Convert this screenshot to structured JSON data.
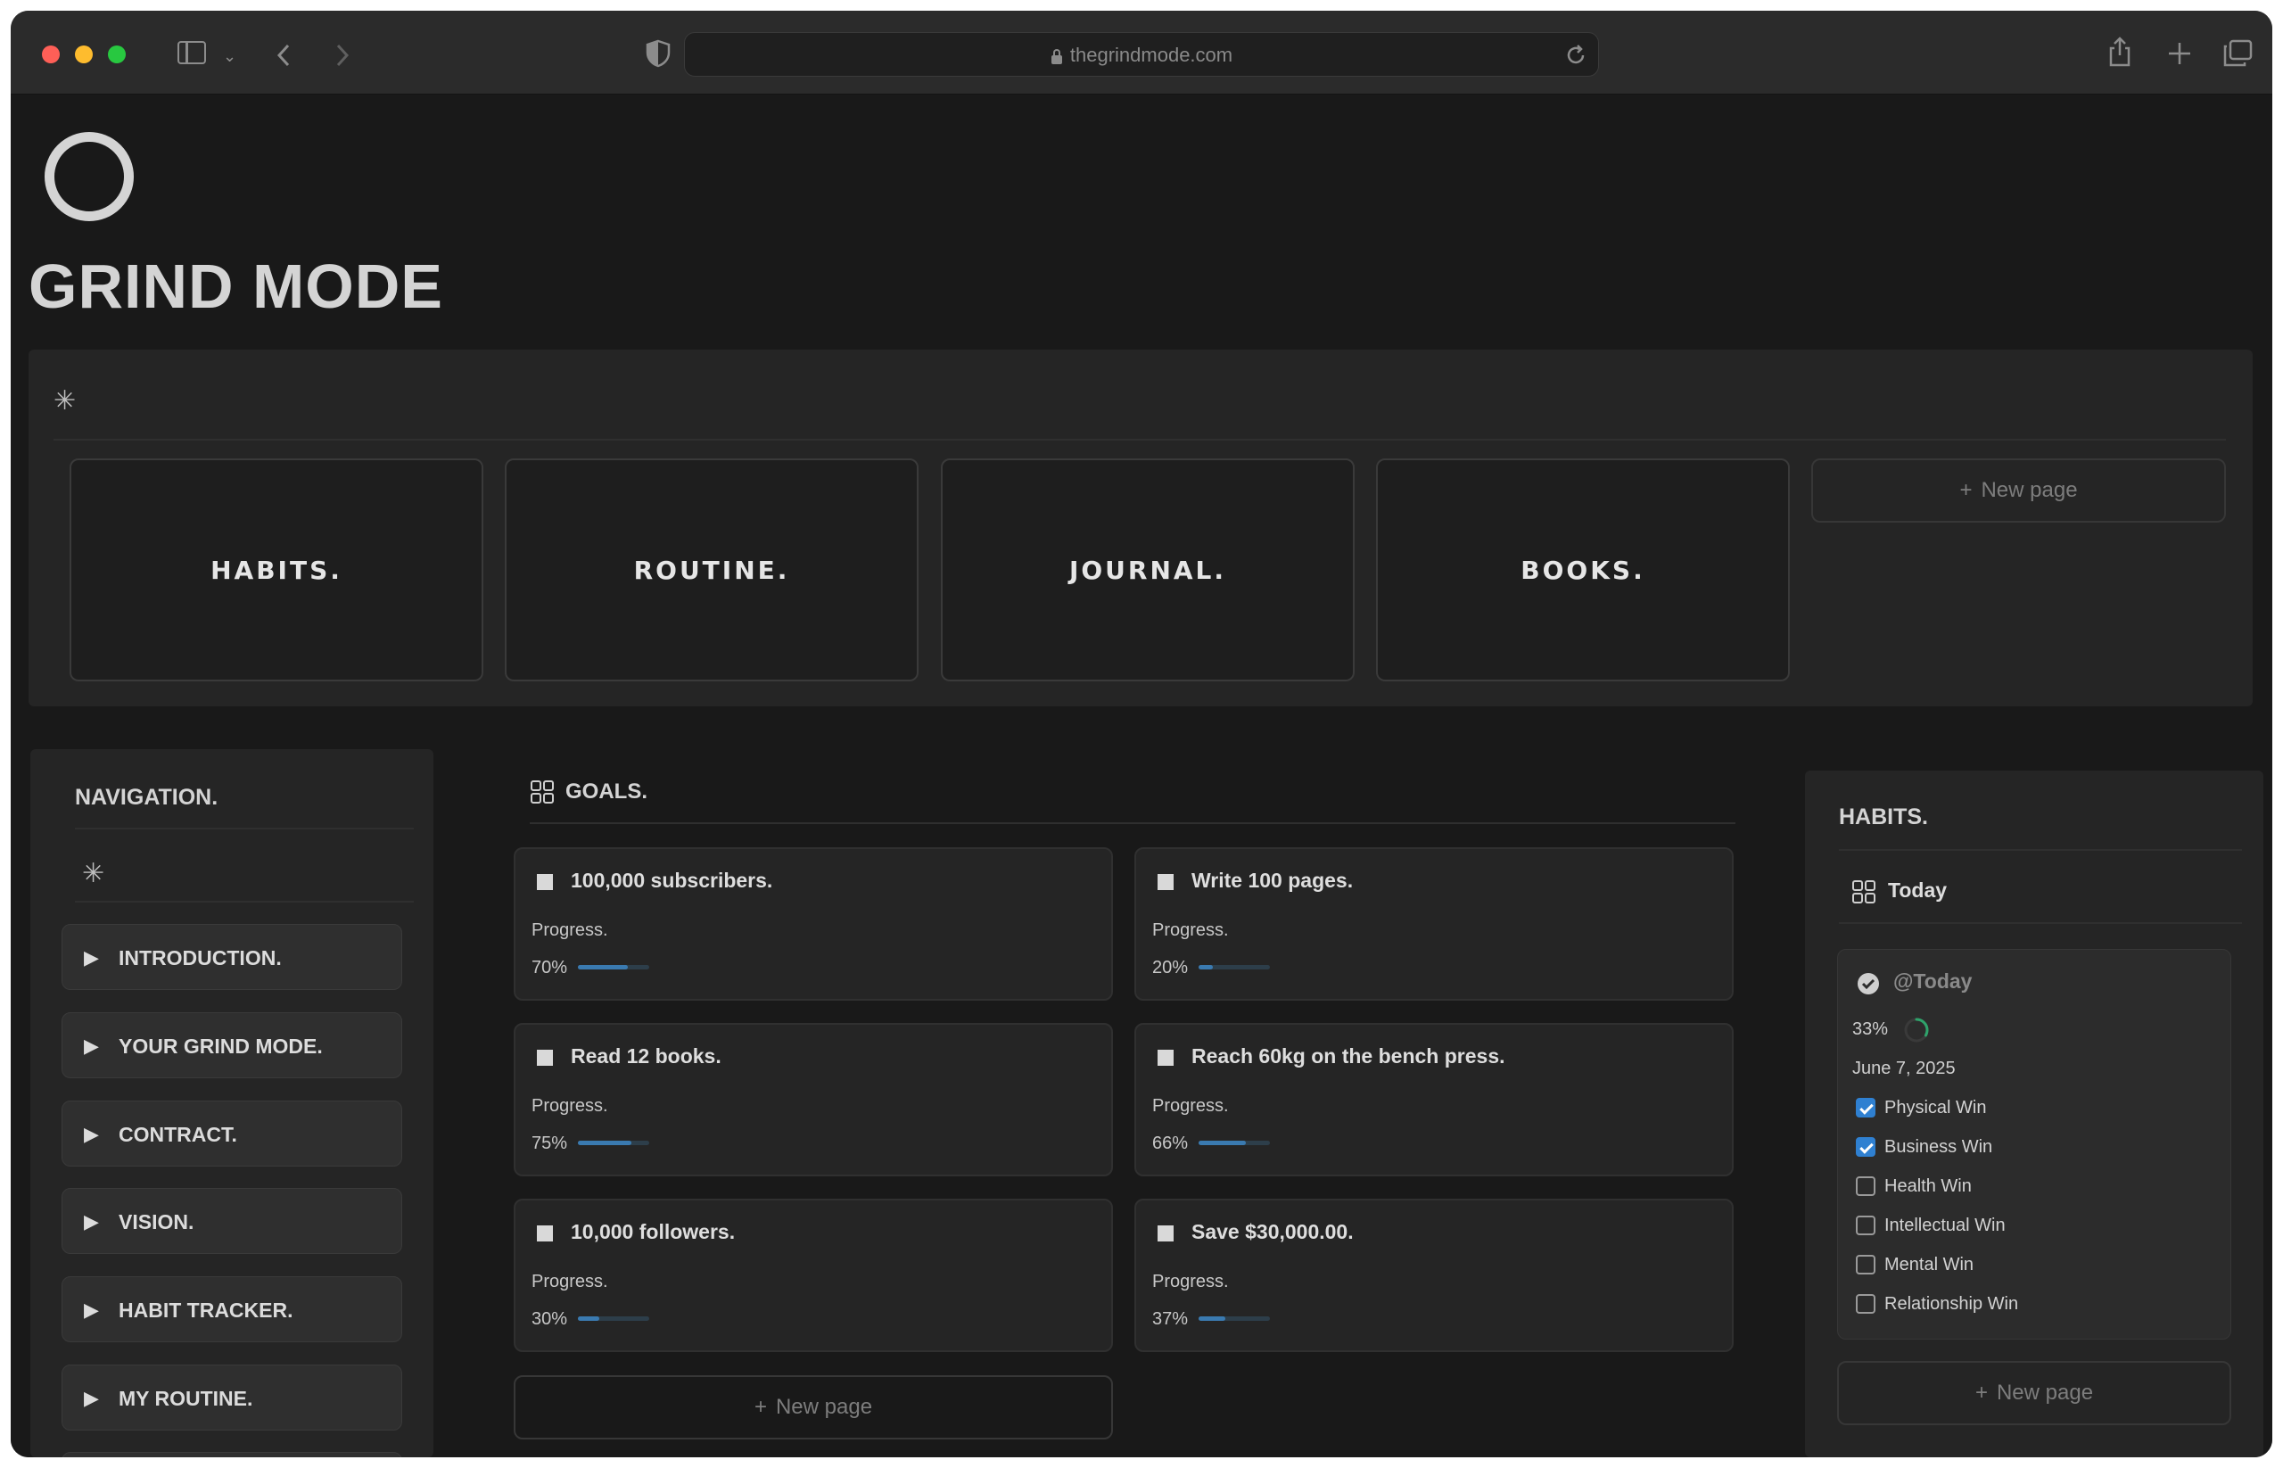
{
  "browser": {
    "url": "thegrindmode.com"
  },
  "page": {
    "title": "GRIND MODE"
  },
  "gallery": {
    "cards": [
      "HABITS.",
      "ROUTINE.",
      "JOURNAL.",
      "BOOKS."
    ],
    "new_page": "New page"
  },
  "navigation": {
    "title": "NAVIGATION.",
    "items": [
      "INTRODUCTION.",
      "YOUR GRIND MODE.",
      "CONTRACT.",
      "VISION.",
      "HABIT TRACKER.",
      "MY ROUTINE."
    ]
  },
  "goals": {
    "title": "GOALS.",
    "new_page": "New page",
    "items": [
      {
        "name": "100,000 subscribers.",
        "progress_label": "Progress.",
        "percent": "70%",
        "value": 70
      },
      {
        "name": "Write 100 pages.",
        "progress_label": "Progress.",
        "percent": "20%",
        "value": 20
      },
      {
        "name": "Read 12 books.",
        "progress_label": "Progress.",
        "percent": "75%",
        "value": 75
      },
      {
        "name": "Reach 60kg on the bench press.",
        "progress_label": "Progress.",
        "percent": "66%",
        "value": 66
      },
      {
        "name": "10,000 followers.",
        "progress_label": "Progress.",
        "percent": "30%",
        "value": 30
      },
      {
        "name": "Save $30,000.00.",
        "progress_label": "Progress.",
        "percent": "37%",
        "value": 37
      }
    ]
  },
  "habits": {
    "title": "HABITS.",
    "view": "Today",
    "card": {
      "title": "@Today",
      "percent": "33%",
      "ring_value": 33,
      "date": "June 7, 2025",
      "items": [
        {
          "label": "Physical Win",
          "checked": true
        },
        {
          "label": "Business Win",
          "checked": true
        },
        {
          "label": "Health Win",
          "checked": false
        },
        {
          "label": "Intellectual Win",
          "checked": false
        },
        {
          "label": "Mental Win",
          "checked": false
        },
        {
          "label": "Relationship Win",
          "checked": false
        }
      ]
    },
    "new_page": "New page"
  },
  "colors": {
    "background": "#191919",
    "panel": "#252525",
    "accent": "#2f80d1",
    "progress": "#3a7ab0",
    "ring": "#2fa36b"
  }
}
